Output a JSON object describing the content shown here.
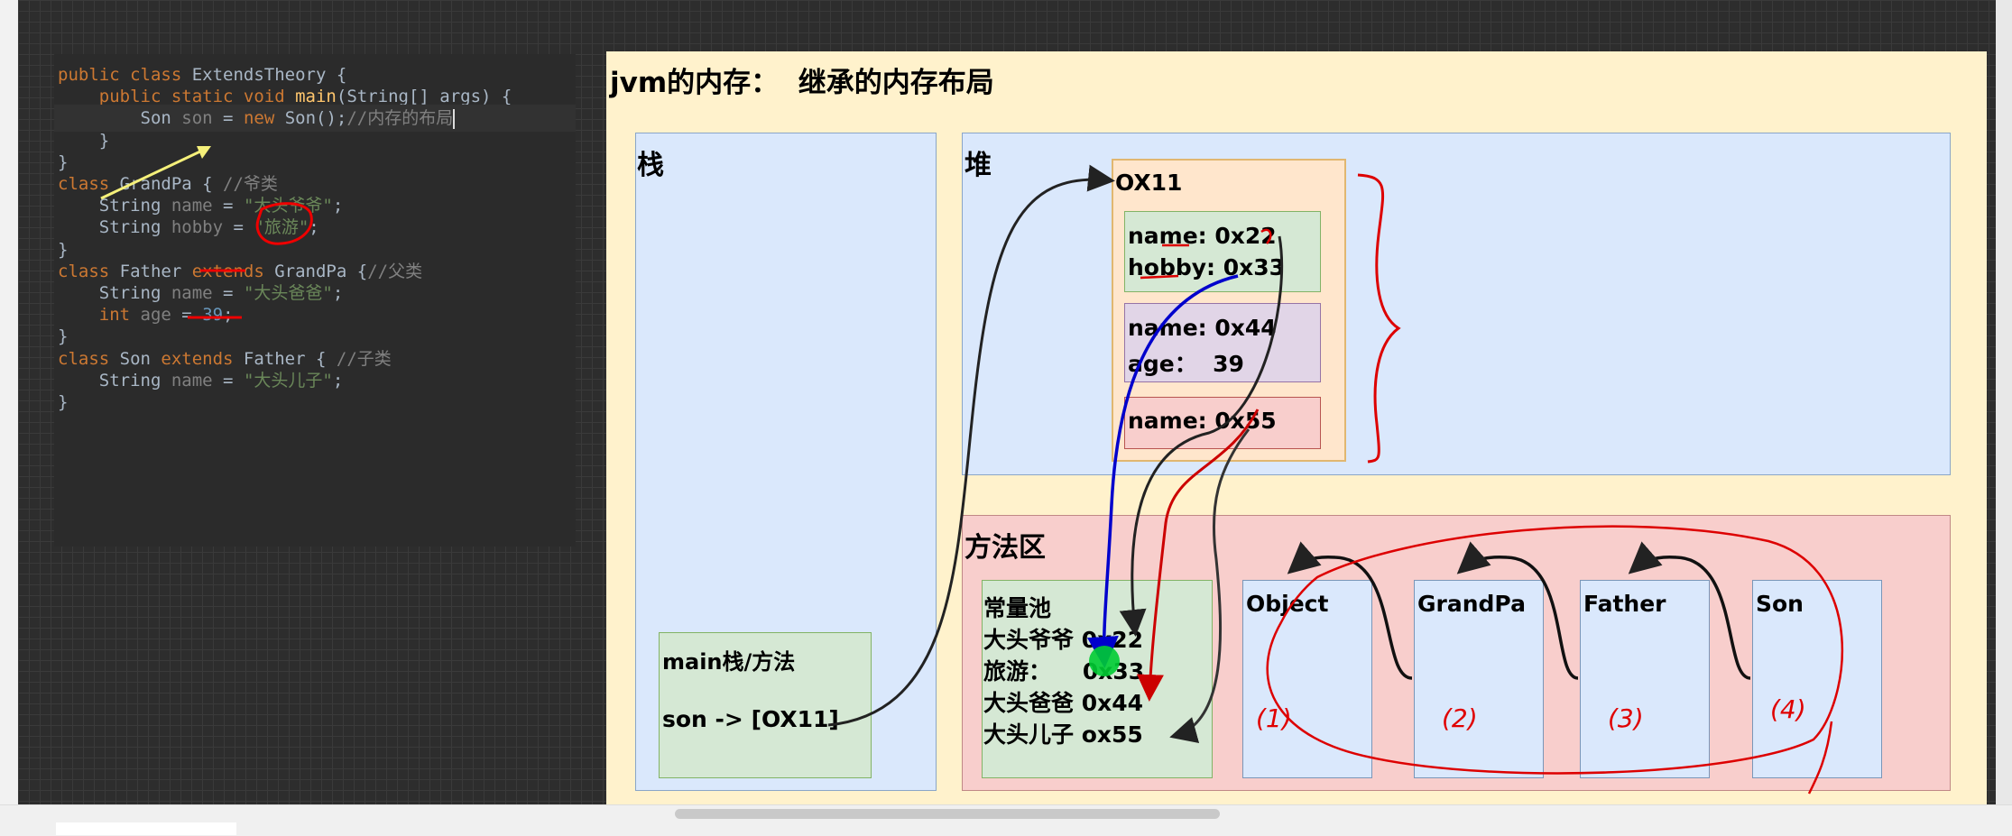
{
  "code": {
    "lines": [
      [
        [
          "kw",
          "public class "
        ],
        [
          "def",
          "ExtendsTheory {"
        ]
      ],
      [
        [
          "def",
          "    "
        ],
        [
          "kw",
          "public static void "
        ],
        [
          "fn",
          "main"
        ],
        [
          "def",
          "(String[] args) {"
        ]
      ],
      [
        [
          "def",
          "        Son "
        ],
        [
          "dim",
          "son"
        ],
        [
          "def",
          " = "
        ],
        [
          "kw",
          "new "
        ],
        [
          "def",
          "Son();"
        ],
        [
          "cmt",
          "//内存的布局"
        ]
      ],
      [
        [
          "def",
          "    }"
        ]
      ],
      [
        [
          "def",
          "}"
        ]
      ],
      [
        [
          "kw",
          "class "
        ],
        [
          "def",
          "GrandPa { "
        ],
        [
          "cmt",
          "//爷类"
        ]
      ],
      [
        [
          "def",
          "    String "
        ],
        [
          "dim",
          "name"
        ],
        [
          "def",
          " = "
        ],
        [
          "str",
          "\"大头爷爷\""
        ],
        [
          "def",
          ";"
        ]
      ],
      [
        [
          "def",
          "    String "
        ],
        [
          "dim",
          "hobby"
        ],
        [
          "def",
          " = "
        ],
        [
          "str",
          "\"旅游\""
        ],
        [
          "def",
          ";"
        ]
      ],
      [
        [
          "def",
          "}"
        ]
      ],
      [
        [
          "kw",
          "class "
        ],
        [
          "def",
          "Father "
        ],
        [
          "kw",
          "extends "
        ],
        [
          "def",
          "GrandPa {"
        ],
        [
          "cmt",
          "//父类"
        ]
      ],
      [
        [
          "def",
          "    String "
        ],
        [
          "dim",
          "name"
        ],
        [
          "def",
          " = "
        ],
        [
          "str",
          "\"大头爸爸\""
        ],
        [
          "def",
          ";"
        ]
      ],
      [
        [
          "def",
          "    "
        ],
        [
          "kw",
          "int "
        ],
        [
          "dim",
          "age"
        ],
        [
          "def",
          " = "
        ],
        [
          "num",
          "39"
        ],
        [
          "def",
          ";"
        ]
      ],
      [
        [
          "def",
          "}"
        ]
      ],
      [
        [
          "kw",
          "class "
        ],
        [
          "def",
          "Son "
        ],
        [
          "kw",
          "extends "
        ],
        [
          "def",
          "Father { "
        ],
        [
          "cmt",
          "//子类"
        ]
      ],
      [
        [
          "def",
          "    String "
        ],
        [
          "dim",
          "name"
        ],
        [
          "def",
          " = "
        ],
        [
          "str",
          "\"大头儿子\""
        ],
        [
          "def",
          ";"
        ]
      ],
      [
        [
          "def",
          "}"
        ]
      ]
    ]
  },
  "diagram": {
    "title": "jvm的内存：  继承的内存布局",
    "stack_label": "栈",
    "heap_label": "堆",
    "method_area_label": "方法区",
    "heap_object": {
      "address": "OX11",
      "grandpa_fields": [
        "name: 0x22",
        "hobby: 0x33"
      ],
      "father_fields": [
        "name: 0x44",
        "age：  39"
      ],
      "son_fields": [
        "name: 0x55"
      ]
    },
    "main_frame": {
      "title": "main栈/方法",
      "ref": "son -> [OX11]"
    },
    "constant_pool": {
      "title": "常量池",
      "entries": [
        "大头爷爷 0x22",
        "旅游：    0x33",
        "大头爸爸 0x44",
        "大头儿子 ox55"
      ]
    },
    "classes": [
      "Object",
      "GrandPa",
      "Father",
      "Son"
    ],
    "annotations": [
      "(1)",
      "(2)",
      "(3)",
      "(4)"
    ]
  },
  "colors": {
    "diagram_bg": "#fff2cc",
    "area_blue": "#dae8fc",
    "area_red": "#f8cecc",
    "object_orange": "#ffe6cc",
    "green": "#d5e8d4",
    "purple": "#e1d5e7",
    "annotation_red": "#e00000",
    "arrow_blue": "#0000cc",
    "highlight_yellow": "#f5f07a"
  }
}
